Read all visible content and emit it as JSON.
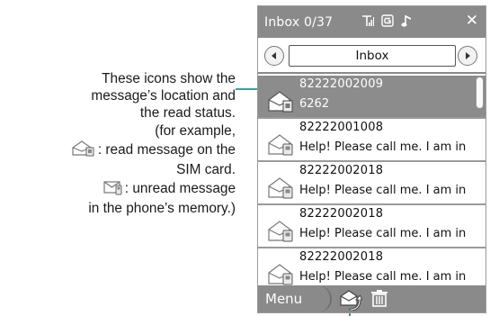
{
  "annotation": {
    "line1": "These icons show the",
    "line2": "message’s location and",
    "line3": "the read status.",
    "line4": "(for example,",
    "line5": ": read message on the",
    "line6": "SIM card.",
    "line7": ": unread message",
    "line8": "in the phone’s memory.)"
  },
  "phone": {
    "title": "Inbox 0/37",
    "nav_value": "Inbox",
    "messages": [
      {
        "sender": "82222002009",
        "preview": "6262",
        "selected": true,
        "icon": "read-sim-envelope-icon"
      },
      {
        "sender": "82222001008",
        "preview": "Help! Please call me. I am in",
        "selected": false,
        "icon": "read-phone-envelope-icon"
      },
      {
        "sender": "82222002018",
        "preview": "Help! Please call me. I am in",
        "selected": false,
        "icon": "read-phone-envelope-icon"
      },
      {
        "sender": "82222002018",
        "preview": "Help! Please call me. I am in",
        "selected": false,
        "icon": "read-phone-envelope-icon"
      },
      {
        "sender": "82222002018",
        "preview": "Help! Please call me. I am in",
        "selected": false,
        "icon": "read-phone-envelope-icon"
      }
    ],
    "softkeys": {
      "menu": "Menu"
    },
    "colors": {
      "bar": "#8a8a8a",
      "selected": "#8c8c8c",
      "leader": "#2aa6a6"
    }
  }
}
